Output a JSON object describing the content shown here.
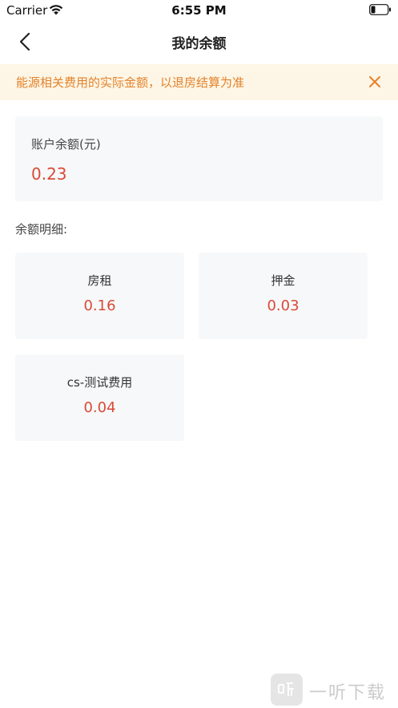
{
  "status_bar": {
    "carrier": "Carrier",
    "time": "6:55 PM"
  },
  "nav": {
    "title": "我的余额"
  },
  "notice": {
    "text": "能源相关费用的实际金额，以退房结算为准",
    "color": "#e4822b",
    "background": "#fdf6e6"
  },
  "balance": {
    "label": "账户余额(元)",
    "value": "0.23"
  },
  "details": {
    "heading": "余额明细:",
    "items": [
      {
        "name": "房租",
        "amount": "0.16"
      },
      {
        "name": "押金",
        "amount": "0.03"
      },
      {
        "name": "cs-测试费用",
        "amount": "0.04"
      }
    ]
  },
  "watermark": {
    "text": "一听下载"
  },
  "colors": {
    "amount": "#d94a38",
    "card_background": "#f7f8f9"
  }
}
